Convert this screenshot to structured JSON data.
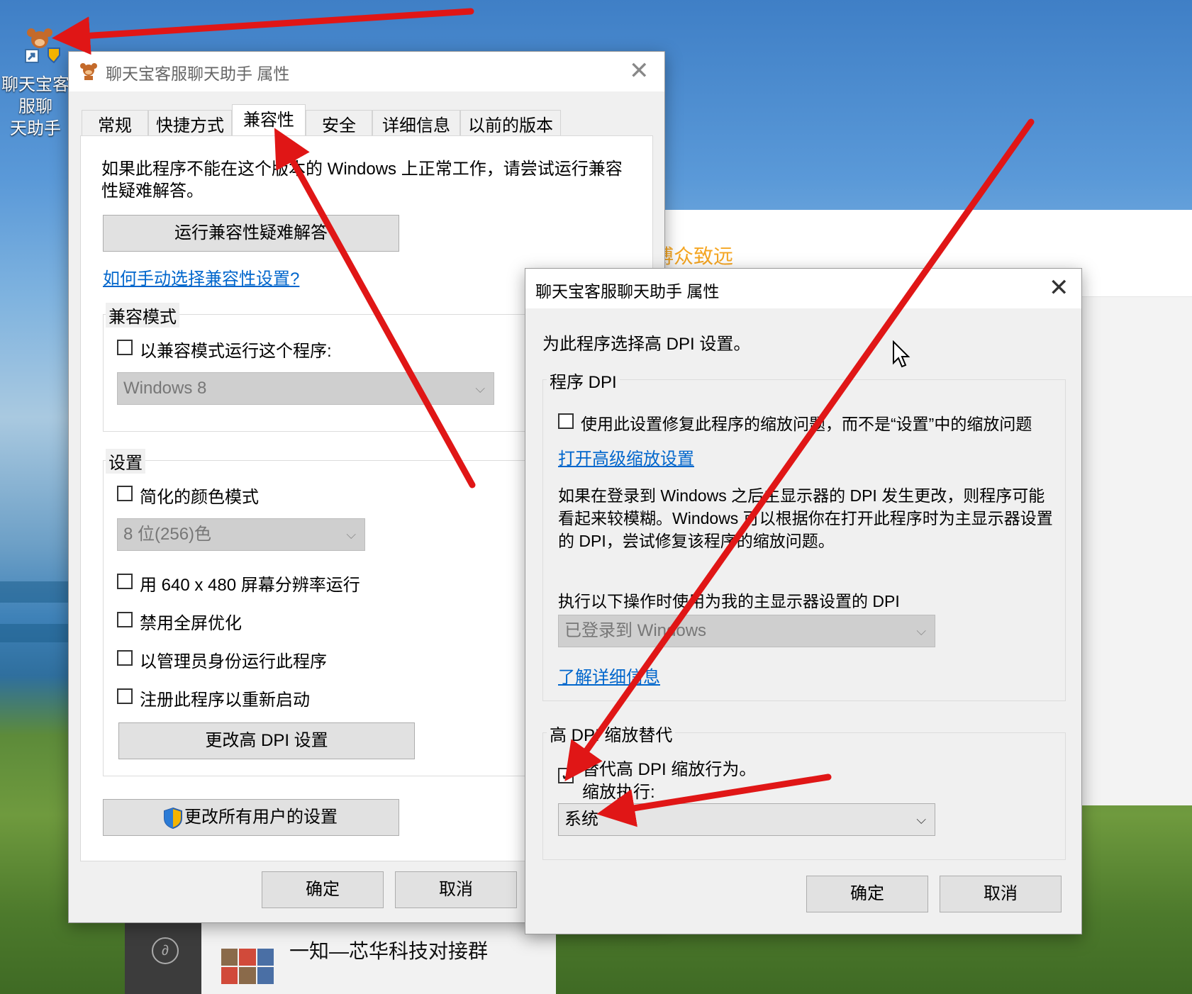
{
  "desktop": {
    "shortcut_label": "聊天宝客服聊\n天助手",
    "bg_app_text": "博众致远",
    "chat_title": "一知—芯华科技对接群"
  },
  "props_window": {
    "title": "聊天宝客服聊天助手 属性",
    "tabs": [
      "常规",
      "快捷方式",
      "兼容性",
      "安全",
      "详细信息",
      "以前的版本"
    ],
    "active_tab": "兼容性",
    "intro": "如果此程序不能在这个版本的 Windows 上正常工作，请尝试运行兼容性疑难解答。",
    "troubleshoot_button": "运行兼容性疑难解答",
    "manual_link": "如何手动选择兼容性设置?",
    "compat_mode": {
      "title": "兼容模式",
      "checkbox_label": "以兼容模式运行这个程序:",
      "checked": false,
      "select_value": "Windows 8"
    },
    "settings": {
      "title": "设置",
      "reduced_color_label": "简化的颜色模式",
      "color_select_value": "8 位(256)色",
      "res_640_label": "用 640 x 480 屏幕分辨率运行",
      "disable_fullscreen_label": "禁用全屏优化",
      "run_as_admin_label": "以管理员身份运行此程序",
      "register_restart_label": "注册此程序以重新启动",
      "dpi_button": "更改高 DPI 设置"
    },
    "all_users_button": "更改所有用户的设置",
    "ok_button": "确定",
    "cancel_button": "取消"
  },
  "dpi_dialog": {
    "title": "聊天宝客服聊天助手 属性",
    "intro": "为此程序选择高 DPI 设置。",
    "program_dpi": {
      "title": "程序 DPI",
      "checkbox_label": "使用此设置修复此程序的缩放问题，而不是“设置”中的缩放问题",
      "checked": false,
      "advanced_link": "打开高级缩放设置",
      "description": "如果在登录到 Windows 之后主显示器的 DPI 发生更改，则程序可能看起来较模糊。Windows 可以根据你在打开此程序时为主显示器设置的 DPI，尝试修复该程序的缩放问题。",
      "use_dpi_label": "执行以下操作时使用为我的主显示器设置的 DPI",
      "select_value": "已登录到 Windows",
      "learn_more_link": "了解详细信息"
    },
    "override": {
      "title": "高 DPI 缩放替代",
      "checkbox_label": "替代高 DPI 缩放行为。",
      "checked": true,
      "performed_by_label": "缩放执行:",
      "select_value": "系统"
    },
    "ok_button": "确定",
    "cancel_button": "取消"
  },
  "colors": {
    "annotation_arrow": "#e01616",
    "link": "#0066cc",
    "accent_orange": "#f5a623"
  }
}
